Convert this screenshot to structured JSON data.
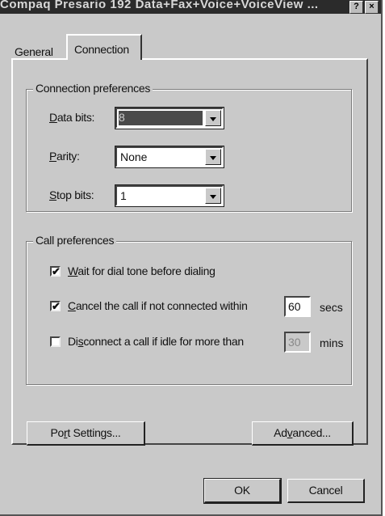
{
  "window": {
    "title": "Compaq Presario 192 Data+Fax+Voice+VoiceView ...",
    "help_glyph": "?",
    "close_glyph": "×"
  },
  "tabs": [
    {
      "label": "General",
      "active": false
    },
    {
      "label": "Connection",
      "active": true
    }
  ],
  "connection_preferences": {
    "group_label": "Connection preferences",
    "data_bits": {
      "label_prefix": "",
      "label_u": "D",
      "label_rest": "ata bits:",
      "value": "8",
      "selected": true
    },
    "parity": {
      "label_u": "P",
      "label_rest": "arity:",
      "value": "None"
    },
    "stop_bits": {
      "label_u": "S",
      "label_rest": "top bits:",
      "value": "1"
    }
  },
  "call_preferences": {
    "group_label": "Call preferences",
    "wait_dial_tone": {
      "checked": true,
      "check_glyph": "✔",
      "label_u": "W",
      "label_rest": "ait for dial tone before dialing"
    },
    "cancel_call": {
      "checked": true,
      "check_glyph": "✔",
      "label_u": "C",
      "label_rest": "ancel the call if not connected within",
      "value": "60",
      "unit": "secs"
    },
    "disconnect_idle": {
      "checked": false,
      "label_pre": "Di",
      "label_u": "s",
      "label_rest": "connect a call if idle for more than",
      "value": "30",
      "unit": "mins"
    }
  },
  "buttons": {
    "port_settings": {
      "pre": "Po",
      "u": "r",
      "rest": "t Settings..."
    },
    "advanced": {
      "pre": "Ad",
      "u": "v",
      "rest": "anced..."
    },
    "ok": "OK",
    "cancel": "Cancel"
  }
}
